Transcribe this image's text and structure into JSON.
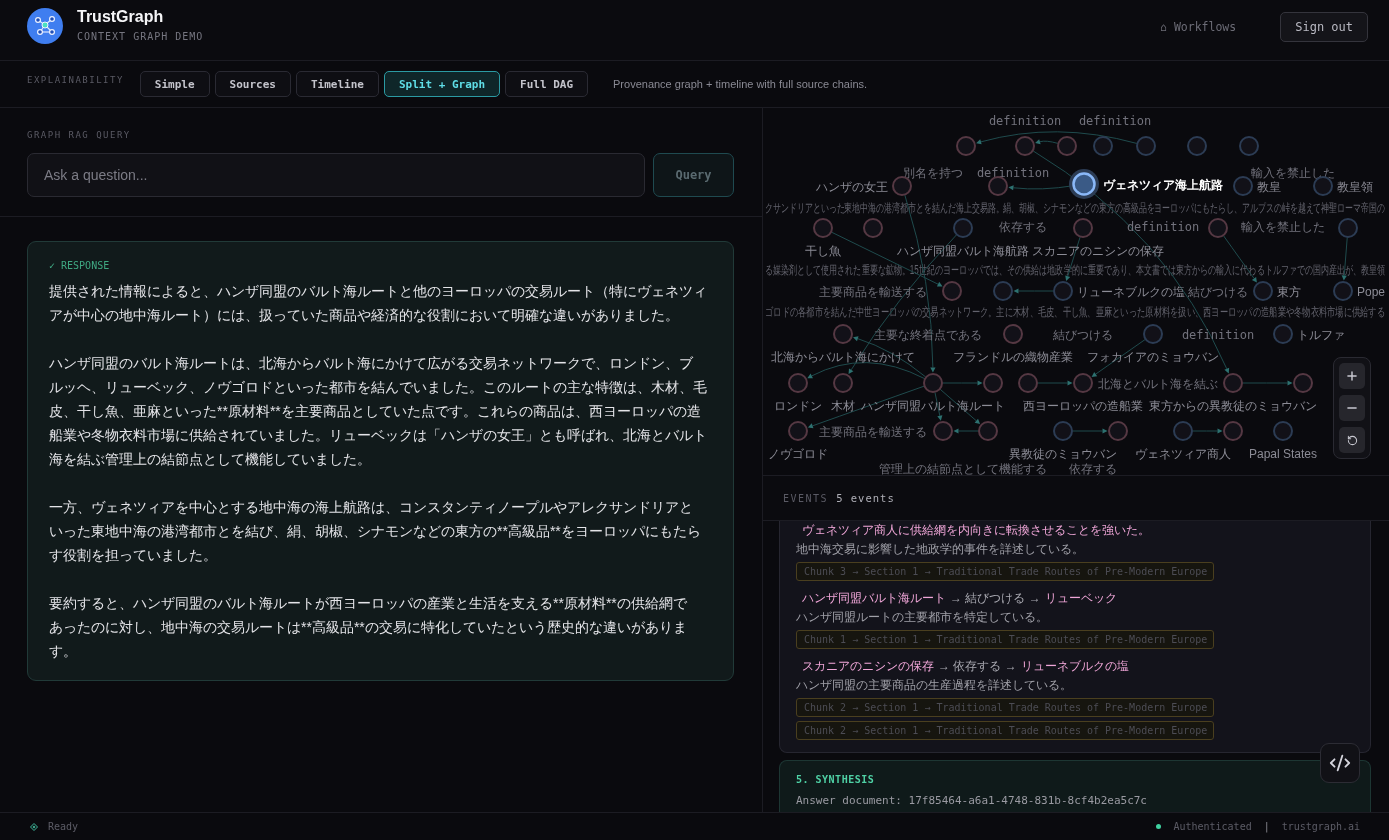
{
  "header": {
    "title": "TrustGraph",
    "subtitle": "CONTEXT GRAPH DEMO",
    "nav_link": "⌂ Workflows",
    "sign_out": "Sign out"
  },
  "explainability": {
    "label": "EXPLAINABILITY",
    "tabs": [
      {
        "label": "Simple",
        "selected": false
      },
      {
        "label": "Sources",
        "selected": false
      },
      {
        "label": "Timeline",
        "selected": false
      },
      {
        "label": "Split + Graph",
        "selected": true
      },
      {
        "label": "Full DAG",
        "selected": false
      }
    ],
    "description": "Provenance graph + timeline with full source chains."
  },
  "query": {
    "label": "GRAPH RAG QUERY",
    "placeholder": "Ask a question...",
    "button": {
      "label": "Query",
      "disabled": true
    }
  },
  "response": {
    "label": "✓ RESPONSE",
    "paragraphs": [
      "提供された情報によると、ハンザ同盟のバルト海ルートと他のヨーロッパの交易ルート（特にヴェネツィアが中心の地中海ルート）には、扱っていた商品や経済的な役割において明確な違いがありました。",
      "ハンザ同盟のバルト海ルートは、北海からバルト海にかけて広がる交易ネットワークで、ロンドン、ブルッヘ、リューベック、ノヴゴロドといった都市を結んでいました。このルートの主な特徴は、木材、毛皮、干し魚、亜麻といった**原材料**を主要商品としていた点です。これらの商品は、西ヨーロッパの造船業や冬物衣料市場に供給されていました。リューベックは「ハンザの女王」とも呼ばれ、北海とバルト海を結ぶ管理上の結節点として機能していました。",
      "一方、ヴェネツィアを中心とする地中海の海上航路は、コンスタンティノープルやアレクサンドリアといった東地中海の港湾都市とを結び、絹、胡椒、シナモンなどの東方の**高級品**をヨーロッパにもたらす役割を担っていました。",
      "要約すると、ハンザ同盟のバルト海ルートが西ヨーロッパの産業と生活を支える**原材料**の供給網であったのに対し、地中海の交易ルートは**高級品**の交易に特化していたという歴史的な違いがあります。"
    ]
  },
  "graph": {
    "nodes": [
      {
        "color": "#553843",
        "selected": false
      },
      {
        "color": "#553843",
        "selected": false
      },
      {
        "color": "#553843",
        "selected": false
      },
      {
        "color": "#2c3c54",
        "selected": false
      },
      {
        "color": "#2c3c54",
        "selected": false
      },
      {
        "color": "#2c3c54",
        "selected": false
      },
      {
        "color": "#2c3c54",
        "selected": false
      },
      {
        "label": "ハンザの女王",
        "color": "#553843",
        "selected": false
      },
      {
        "color": "#553843",
        "selected": false
      },
      {
        "label": "ヴェネツィア海上航路",
        "color": "#2c3c54",
        "selected": true
      },
      {
        "label": "教皇",
        "color": "#2c3c54",
        "selected": false
      },
      {
        "label": "教皇領",
        "color": "#2c3c54",
        "selected": false
      },
      {
        "label": "干し魚",
        "color": "#553843",
        "selected": false
      },
      {
        "color": "#553843",
        "selected": false
      },
      {
        "label": "ハンザ同盟バルト海航路",
        "color": "#2c3c54",
        "selected": false
      },
      {
        "label": "スカニアのニシンの保存",
        "color": "#553843",
        "selected": false
      },
      {
        "color": "#553843",
        "selected": false
      },
      {
        "color": "#2c3c54",
        "selected": false
      },
      {
        "color": "#553843",
        "selected": false
      },
      {
        "color": "#2c3c54",
        "selected": false
      },
      {
        "label": "リューネブルクの塩",
        "color": "#2c3c54",
        "selected": false
      },
      {
        "label": "東方",
        "color": "#2c3c54",
        "selected": false
      },
      {
        "label": "Pope",
        "color": "#2c3c54",
        "selected": false
      },
      {
        "label": "北海からバルト海にかけて",
        "color": "#553843",
        "selected": false
      },
      {
        "label": "フランドルの織物産業",
        "color": "#553843",
        "selected": false
      },
      {
        "label": "フォカイアのミョウバン",
        "color": "#2c3c54",
        "selected": false
      },
      {
        "label": "トルファ",
        "color": "#2c3c54",
        "selected": false
      },
      {
        "label": "ロンドン",
        "color": "#553843",
        "selected": false
      },
      {
        "label": "木材",
        "color": "#553843",
        "selected": false
      },
      {
        "label": "ハンザ同盟バルト海ルート",
        "color": "#553843",
        "selected": false
      },
      {
        "color": "#553843",
        "selected": false
      },
      {
        "color": "#553843",
        "selected": false
      },
      {
        "label": "西ヨーロッパの造船業",
        "color": "#553843",
        "selected": false
      },
      {
        "label": "東方からの異教徒のミョウバン",
        "color": "#553843",
        "selected": false
      },
      {
        "color": "#553843",
        "selected": false
      },
      {
        "label": "ノヴゴロド",
        "color": "#553843",
        "selected": false
      },
      {
        "color": "#553843",
        "selected": false
      },
      {
        "color": "#553843",
        "selected": false
      },
      {
        "label": "異教徒のミョウバン",
        "color": "#2c3c54",
        "selected": false
      },
      {
        "color": "#553843",
        "selected": false
      },
      {
        "label": "ヴェネツィア商人",
        "color": "#2c3c54",
        "selected": false
      },
      {
        "color": "#553843",
        "selected": false
      },
      {
        "label": "Papal States",
        "color": "#2c3c54",
        "selected": false
      }
    ],
    "edge_labels": [
      "definition",
      "definition",
      "別名を持つ",
      "definition",
      "輸入を禁止した",
      "依存する",
      "definition",
      "輸入を禁止した",
      "主要商品を輸送する",
      "結びつける",
      "主要な終着点である",
      "結びつける",
      "definition",
      "北海とバルト海を結ぶ",
      "主要商品を輸送する",
      "管理上の結節点として機能する",
      "依存する"
    ],
    "descriptions": [
      "クサンドリアといった東地中海の港湾都市とを結んだ海上交易路。絹、胡椒、シナモンなどの東方の高級品をヨーロッパにもたらし、アルプスの峠を越えて神聖ローマ帝国の",
      "る媒染剤として使用された重要な鉱物。15世紀のヨーロッパでは、その供給は地政学的に重要であり、本文書では東方からの輸入に代わるトルファでの国内産出が、教皇領",
      "ゴロドの各都市を結んだ中世ヨーロッパの交易ネットワーク。主に木材、毛皮、干し魚、亜麻といった原材料を扱い、西ヨーロッパの造船業や冬物衣料市場に供給する"
    ]
  },
  "events": {
    "label": "EVENTS",
    "count": "5 events",
    "items": [
      {
        "triple": [
          {
            "kind": "entity",
            "text": "ヴェネツィア商人に供給網を内向きに転換させることを強いた。"
          }
        ],
        "description": "地中海交易に影響した地政学的事件を詳述している。",
        "chunks": [
          "Chunk 3 → Section 1 → Traditional Trade Routes of Pre-Modern Europe"
        ]
      },
      {
        "triple": [
          {
            "kind": "entity",
            "text": "ハンザ同盟バルト海ルート"
          },
          {
            "kind": "relation",
            "text": "→ 結びつける →"
          },
          {
            "kind": "entity",
            "text": "リューベック"
          }
        ],
        "description": "ハンザ同盟ルートの主要都市を特定している。",
        "chunks": [
          "Chunk 1 → Section 1 → Traditional Trade Routes of Pre-Modern Europe"
        ]
      },
      {
        "triple": [
          {
            "kind": "entity",
            "text": "スカニアのニシンの保存"
          },
          {
            "kind": "relation",
            "text": "→ 依存する →"
          },
          {
            "kind": "entity",
            "text": "リューネブルクの塩"
          }
        ],
        "description": "ハンザ同盟の主要商品の生産過程を詳述している。",
        "chunks": [
          "Chunk 2 → Section 1 → Traditional Trade Routes of Pre-Modern Europe",
          "Chunk 2 → Section 1 → Traditional Trade Routes of Pre-Modern Europe"
        ]
      }
    ],
    "synthesis": {
      "title": "5. SYNTHESIS",
      "text": "Answer document: 17f85464-a6a1-4748-831b-8cf4b2ea5c7c"
    }
  },
  "status_bar": {
    "status": "Ready",
    "auth": "Authenticated",
    "separator": "|",
    "site": "trustgraph.ai"
  }
}
